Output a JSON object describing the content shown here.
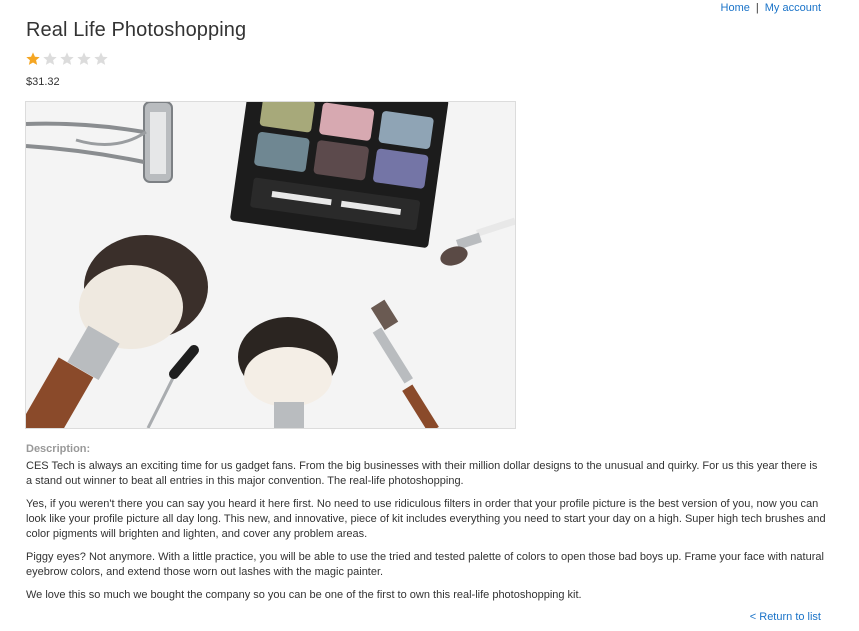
{
  "nav": {
    "home_label": "Home",
    "separator": "|",
    "account_label": "My account"
  },
  "product": {
    "title": "Real Life Photoshopping",
    "rating": 1,
    "rating_max": 5,
    "price": "$31.32",
    "image_icon": "makeup-brushes-eyeshadow-palette-photo",
    "description_label": "Description:",
    "description": [
      "CES Tech is always an exciting time for us gadget fans. From the big businesses with their million dollar designs to the unusual and quirky. For us this year there is a stand out winner to beat all entries in this major convention. The real-life photoshopping.",
      "Yes, if you weren't there you can say you heard it here first. No need to use ridiculous filters in order that your profile picture is the best version of you, now you can look like your profile picture all day long. This new, and innovative, piece of kit includes everything you need to start your day on a high. Super high tech brushes and color pigments will brighten and lighten, and cover any problem areas.",
      "Piggy eyes? Not anymore. With a little practice, you will be able to use the tried and tested palette of colors to open those bad boys up. Frame your face with natural eyebrow colors, and extend those worn out lashes with the magic painter.",
      "We love this so much we bought the company so you can be one of the first to own this real-life photoshopping kit."
    ]
  },
  "footer": {
    "return_label": "< Return to list"
  },
  "colors": {
    "link": "#1a73c8",
    "star_filled": "#f5a623",
    "star_empty": "#dcdcdc",
    "label_gray": "#999999"
  }
}
